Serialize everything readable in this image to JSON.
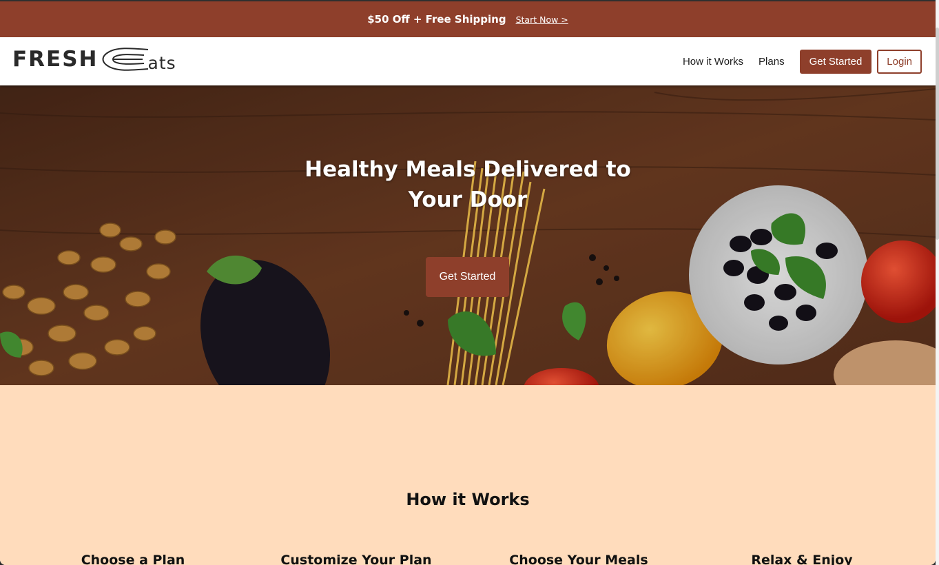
{
  "promo": {
    "text": "$50 Off + Free Shipping",
    "link": "Start Now >"
  },
  "header": {
    "logo_left": "FRESH",
    "logo_right": "ats",
    "nav": [
      "How it Works",
      "Plans"
    ],
    "cta": "Get Started",
    "login": "Login"
  },
  "hero": {
    "title": "Healthy Meals Delivered to Your Door",
    "cta": "Get Started"
  },
  "how_it_works": {
    "title": "How it Works",
    "steps": [
      "Choose a Plan",
      "Customize Your Plan",
      "Choose Your Meals",
      "Relax & Enjoy"
    ]
  },
  "colors": {
    "brand": "#8e3f2b",
    "section_bg": "#ffdcbc"
  }
}
